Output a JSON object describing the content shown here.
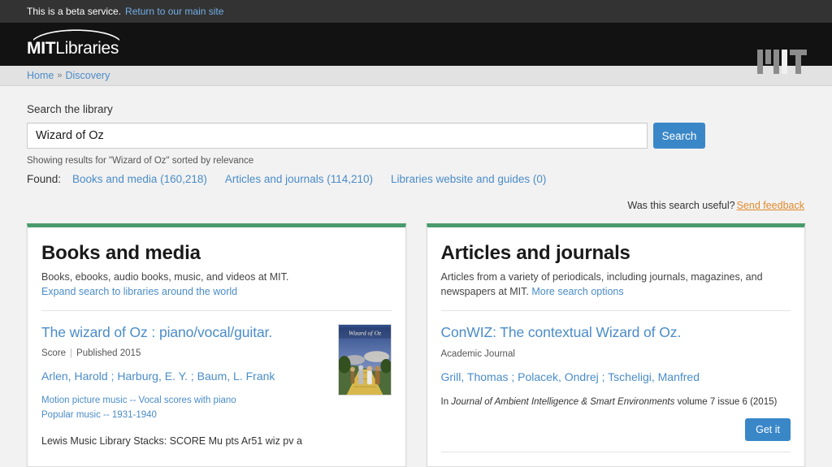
{
  "beta_banner": {
    "message": "This is a beta service.",
    "link_label": "Return to our main site"
  },
  "masthead": {
    "logo_mit": "MIT",
    "logo_libraries": "Libraries",
    "logo_alt": "MIT"
  },
  "breadcrumb": {
    "home": "Home",
    "separator": "»",
    "current": "Discovery"
  },
  "search": {
    "label": "Search the library",
    "value": "Wizard of Oz",
    "placeholder": "Search the library",
    "button_label": "Search",
    "showing_text": "Showing results for \"Wizard of Oz\" sorted by relevance",
    "found_label": "Found:",
    "found_links": [
      "Books and media (160,218)",
      "Articles and journals (114,210)",
      "Libraries website and guides (0)"
    ]
  },
  "feedback": {
    "question": "Was this search useful?",
    "link_label": "Send feedback"
  },
  "books_panel": {
    "title": "Books and media",
    "description": "Books, ebooks, audio books, music, and videos at MIT.",
    "expand_link": "Expand search to libraries around the world",
    "result": {
      "title": "The wizard of Oz : piano/vocal/guitar.",
      "format": "Score",
      "published": "Published 2015",
      "authors": "Arlen, Harold ; Harburg, E. Y. ; Baum, L. Frank",
      "subjects": [
        "Motion picture music -- Vocal scores with piano",
        "Popular music -- 1931-1940"
      ],
      "call_number": "Lewis Music Library Stacks: SCORE Mu pts Ar51 wiz pv a",
      "cover_alt": "The Wizard of Oz book cover"
    }
  },
  "articles_panel": {
    "title": "Articles and journals",
    "description": "Articles from a variety of periodicals, including journals, magazines, and newspapers at MIT.",
    "options_link": "More search options",
    "result": {
      "title": "ConWIZ: The contextual Wizard of Oz.",
      "type": "Academic Journal",
      "authors": "Grill, Thomas ; Polacek, Ondrej ; Tscheligi, Manfred",
      "source_prefix": "In",
      "source_journal": "Journal of Ambient Intelligence & Smart Environments",
      "source_detail": "volume 7 issue 6 (2015)",
      "getit_label": "Get it"
    }
  },
  "colors": {
    "accent_blue": "#3a87c8",
    "link_blue": "#4a8cc8",
    "card_green": "#4a9a6d",
    "feedback_orange": "#e08b2e",
    "masthead_black": "#121212",
    "beta_gray": "#333333"
  }
}
